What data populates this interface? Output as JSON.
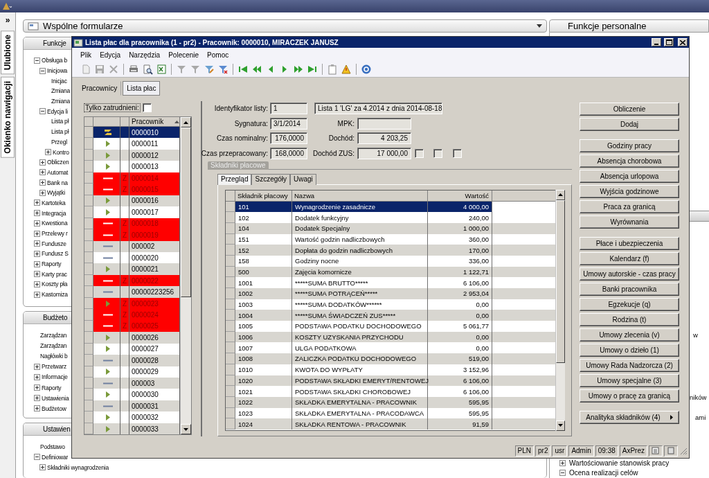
{
  "desktop": {
    "nav_strip": {
      "expand": "»",
      "tabs": [
        "Ulubione",
        "Okienko nawigacji"
      ]
    },
    "forms_selector": {
      "value": "Wspólne formularze"
    },
    "panels": [
      {
        "title": "Funkcje",
        "items": [
          {
            "label": "Obsługa b",
            "kind": "node",
            "expanded": true,
            "children": [
              {
                "label": "Inicjowa",
                "kind": "node",
                "expanded": true,
                "children": [
                  {
                    "label": "Inicjac",
                    "kind": "leaf"
                  },
                  {
                    "label": "Zmiana",
                    "kind": "leaf"
                  },
                  {
                    "label": "Zmiana",
                    "kind": "leaf"
                  }
                ]
              },
              {
                "label": "Edycja li",
                "kind": "node",
                "expanded": true,
                "children": [
                  {
                    "label": "Lista pł",
                    "kind": "leaf"
                  },
                  {
                    "label": "Lista pł",
                    "kind": "leaf"
                  },
                  {
                    "label": "Przegl",
                    "kind": "leaf"
                  },
                  {
                    "label": "Kontro",
                    "kind": "node",
                    "expanded": false
                  }
                ]
              },
              {
                "label": "Obliczen",
                "kind": "node",
                "expanded": false
              },
              {
                "label": "Automat",
                "kind": "node",
                "expanded": false
              },
              {
                "label": "Bank na",
                "kind": "node",
                "expanded": false
              },
              {
                "label": "Wyjątki",
                "kind": "node",
                "expanded": false
              }
            ]
          },
          {
            "label": "Kartoteka",
            "kind": "node",
            "expanded": false
          },
          {
            "label": "Integracja",
            "kind": "node",
            "expanded": false
          },
          {
            "label": "Kwestiona",
            "kind": "node",
            "expanded": false
          },
          {
            "label": "Przelewy r",
            "kind": "node",
            "expanded": false
          },
          {
            "label": "Fundusze",
            "kind": "node",
            "expanded": false
          },
          {
            "label": "Fundusz S",
            "kind": "node",
            "expanded": false
          },
          {
            "label": "Raporty",
            "kind": "node",
            "expanded": false
          },
          {
            "label": "Karty prac",
            "kind": "node",
            "expanded": false
          },
          {
            "label": "Koszty pła",
            "kind": "node",
            "expanded": false
          },
          {
            "label": "Kastomiza",
            "kind": "node",
            "expanded": false
          }
        ]
      },
      {
        "title": "Budżeto",
        "items": [
          {
            "label": "Zarządzan",
            "kind": "leaf"
          },
          {
            "label": "Zarządzan",
            "kind": "leaf"
          },
          {
            "label": "Nagłówki b",
            "kind": "leaf"
          },
          {
            "label": "Przetwarz",
            "kind": "node",
            "expanded": false
          },
          {
            "label": "Informacje",
            "kind": "node",
            "expanded": false
          },
          {
            "label": "Raporty",
            "kind": "node",
            "expanded": false
          },
          {
            "label": "Ustawienia",
            "kind": "node",
            "expanded": false
          },
          {
            "label": "Budżetow",
            "kind": "node",
            "expanded": false
          }
        ]
      },
      {
        "title": "Ustawien",
        "items": [
          {
            "label": "Podstawo",
            "kind": "leaf"
          },
          {
            "label": "Definiowar",
            "kind": "node",
            "expanded": true,
            "children": [
              {
                "label": "Składniki wynagrodzenia",
                "kind": "node",
                "expanded": false
              }
            ]
          }
        ]
      }
    ],
    "personal_panel": {
      "title": "Funkcje personalne",
      "fragments": [
        "w",
        "ników",
        "ami"
      ],
      "items": [
        {
          "label": "Wartościowanie stanowisk pracy",
          "expanded": false
        },
        {
          "label": "Ocena realizacji celów",
          "expanded": true
        }
      ]
    }
  },
  "dialog": {
    "title": "Lista płac dla pracownika (1 - pr2) - Pracownik: 0000010, MIRACZEK JANUSZ",
    "menu": [
      "Plik",
      "Edycja",
      "Narzędzia",
      "Polecenie",
      "Pomoc"
    ],
    "tabs": [
      {
        "label": "Pracownicy",
        "selected": false
      },
      {
        "label": "Lista płac",
        "selected": true
      }
    ],
    "employees": {
      "filter": {
        "label": "Tylko zatrudnieni:",
        "checked": false
      },
      "column": "Pracownik",
      "rows": [
        {
          "id": "0000010",
          "kind": "current",
          "blocked": false,
          "selected": true
        },
        {
          "id": "0000011",
          "kind": "arrow",
          "blocked": false,
          "selected": false
        },
        {
          "id": "0000012",
          "kind": "arrow",
          "blocked": false,
          "selected": false
        },
        {
          "id": "0000013",
          "kind": "arrow",
          "blocked": false,
          "selected": false
        },
        {
          "id": "0000014",
          "kind": "dash",
          "status": "Z",
          "blocked": true,
          "selected": false
        },
        {
          "id": "0000015",
          "kind": "dash",
          "status": "Z",
          "blocked": true,
          "selected": false
        },
        {
          "id": "0000016",
          "kind": "arrow",
          "blocked": false,
          "selected": false
        },
        {
          "id": "0000017",
          "kind": "arrow",
          "blocked": false,
          "selected": false
        },
        {
          "id": "0000018",
          "kind": "dash",
          "status": "Z",
          "blocked": true,
          "selected": false
        },
        {
          "id": "0000019",
          "kind": "dash",
          "status": "Z",
          "blocked": true,
          "selected": false
        },
        {
          "id": "000002",
          "kind": "dash",
          "blocked": false,
          "selected": false
        },
        {
          "id": "0000020",
          "kind": "dash",
          "blocked": false,
          "selected": false
        },
        {
          "id": "0000021",
          "kind": "arrow",
          "blocked": false,
          "selected": false
        },
        {
          "id": "0000022",
          "kind": "dash",
          "status": "Z",
          "blocked": true,
          "selected": false
        },
        {
          "id": "00000223256",
          "kind": "dash",
          "blocked": false,
          "selected": false
        },
        {
          "id": "0000023",
          "kind": "arrow",
          "status": "Z",
          "blocked": true,
          "selected": false
        },
        {
          "id": "0000024",
          "kind": "dash",
          "status": "Z",
          "blocked": true,
          "selected": false
        },
        {
          "id": "0000025",
          "kind": "dash",
          "status": "Z",
          "blocked": true,
          "selected": false
        },
        {
          "id": "0000026",
          "kind": "arrow",
          "blocked": false,
          "selected": false
        },
        {
          "id": "0000027",
          "kind": "arrow",
          "blocked": false,
          "selected": false
        },
        {
          "id": "0000028",
          "kind": "dash",
          "blocked": false,
          "selected": false
        },
        {
          "id": "0000029",
          "kind": "arrow",
          "blocked": false,
          "selected": false
        },
        {
          "id": "000003",
          "kind": "dash",
          "blocked": false,
          "selected": false
        },
        {
          "id": "0000030",
          "kind": "arrow",
          "blocked": false,
          "selected": false
        },
        {
          "id": "0000031",
          "kind": "dash",
          "blocked": false,
          "selected": false
        },
        {
          "id": "0000032",
          "kind": "arrow",
          "blocked": false,
          "selected": false
        },
        {
          "id": "0000033",
          "kind": "arrow",
          "blocked": false,
          "selected": false
        }
      ]
    },
    "form": {
      "list_id": {
        "label": "Identyfikator listy:",
        "value": "1"
      },
      "list_description": {
        "value": "Lista 1 'LG' za 4.2014 z dnia 2014-08-18"
      },
      "signature": {
        "label": "Sygnatura:",
        "value": "3/1/2014"
      },
      "mpk": {
        "label": "MPK:"
      },
      "nominal_time": {
        "label": "Czas nominalny:",
        "value": "176,0000"
      },
      "income": {
        "label": "Dochód:",
        "value": "4 203,25"
      },
      "worked_time": {
        "label": "Czas przepracowany:",
        "value": "168,0000"
      },
      "income_zus": {
        "label": "Dochód ZUS:",
        "value": "17 000,00"
      },
      "flags": [
        {
          "checked": false
        },
        {
          "checked": false
        },
        {
          "checked": false
        }
      ]
    },
    "group_title": "Składniki płacowe",
    "subtabs": [
      {
        "label": "Przegląd",
        "selected": true
      },
      {
        "label": "Szczegóły",
        "selected": false
      },
      {
        "label": "Uwagi",
        "selected": false
      }
    ],
    "pay_table": {
      "columns": [
        "Składnik płacowy",
        "Nazwa",
        "Wartość"
      ],
      "rows": [
        {
          "code": "101",
          "name": "Wynagrodzenie zasadnicze",
          "value": "4 000,00",
          "selected": true
        },
        {
          "code": "102",
          "name": "Dodatek funkcyjny",
          "value": "240,00",
          "selected": false
        },
        {
          "code": "104",
          "name": "Dodatek Specjalny",
          "value": "1 000,00",
          "selected": false
        },
        {
          "code": "151",
          "name": "Wartość godzin nadliczbowych",
          "value": "360,00",
          "selected": false
        },
        {
          "code": "152",
          "name": "Dopłata do godzin nadliczbowych",
          "value": "170,00",
          "selected": false
        },
        {
          "code": "158",
          "name": "Godziny nocne",
          "value": "336,00",
          "selected": false
        },
        {
          "code": "500",
          "name": "Zajęcia komornicze",
          "value": "1 122,71",
          "selected": false
        },
        {
          "code": "1001",
          "name": "*****SUMA BRUTTO*****",
          "value": "6 106,00",
          "selected": false
        },
        {
          "code": "1002",
          "name": "*****SUMA POTRĄCEŃ*****",
          "value": "2 953,04",
          "selected": false
        },
        {
          "code": "1003",
          "name": "*****SUMA DODATKÓW******",
          "value": "0,00",
          "selected": false
        },
        {
          "code": "1004",
          "name": "*****SUMA ŚWIADCZEŃ ZUS*****",
          "value": "0,00",
          "selected": false
        },
        {
          "code": "1005",
          "name": "PODSTAWA PODATKU DOCHODOWEGO",
          "value": "5 061,77",
          "selected": false
        },
        {
          "code": "1006",
          "name": "KOSZTY UZYSKANIA PRZYCHODU",
          "value": "0,00",
          "selected": false
        },
        {
          "code": "1007",
          "name": "ULGA PODATKOWA",
          "value": "0,00",
          "selected": false
        },
        {
          "code": "1008",
          "name": "ZALICZKA PODATKU DOCHODOWEGO",
          "value": "519,00",
          "selected": false
        },
        {
          "code": "1010",
          "name": "KWOTA DO WYPŁATY",
          "value": "3 152,96",
          "selected": false
        },
        {
          "code": "1020",
          "name": "PODSTAWA SKŁADKI EMERYT/RENTOWEJ",
          "value": "6 106,00",
          "selected": false
        },
        {
          "code": "1021",
          "name": "PODSTAWA SKŁADKI CHOROBOWEJ",
          "value": "6 106,00",
          "selected": false
        },
        {
          "code": "1022",
          "name": "SKŁADKA EMERYTALNA - PRACOWNIK",
          "value": "595,95",
          "selected": false
        },
        {
          "code": "1023",
          "name": "SKŁADKA EMERYTALNA - PRACODAWCA",
          "value": "595,95",
          "selected": false
        },
        {
          "code": "1024",
          "name": "SKŁADKA RENTOWA - PRACOWNIK",
          "value": "91,59",
          "selected": false
        }
      ]
    },
    "button_groups": [
      [
        {
          "label": "Obliczenie",
          "submenu": false
        },
        {
          "label": "Dodaj",
          "submenu": false
        }
      ],
      [
        {
          "label": "Godziny pracy",
          "submenu": false
        },
        {
          "label": "Absencja chorobowa",
          "submenu": false
        },
        {
          "label": "Absencja urlopowa",
          "submenu": false
        },
        {
          "label": "Wyjścia godzinowe",
          "submenu": false
        },
        {
          "label": "Praca za granicą",
          "submenu": false
        },
        {
          "label": "Wyrównania",
          "submenu": false
        }
      ],
      [
        {
          "label": "Płace i ubezpieczenia",
          "submenu": false
        },
        {
          "label": "Kalendarz (f)",
          "submenu": false
        },
        {
          "label": "Umowy autorskie - czas pracy",
          "submenu": false
        },
        {
          "label": "Banki pracownika",
          "submenu": false
        },
        {
          "label": "Egzekucje (q)",
          "submenu": false
        },
        {
          "label": "Rodzina (t)",
          "submenu": false
        },
        {
          "label": "Umowy zlecenia (v)",
          "submenu": false
        },
        {
          "label": "Umowy o dzieło (1)",
          "submenu": false
        },
        {
          "label": "Umowy Rada Nadzorcza (2)",
          "submenu": false
        },
        {
          "label": "Umowy specjalne (3)",
          "submenu": false
        },
        {
          "label": "Umowy o pracę za granicą",
          "submenu": false
        }
      ],
      [
        {
          "label": "Analityka składników (4)",
          "submenu": true
        }
      ]
    ],
    "status_bar": [
      "PLN",
      "pr2",
      "usr",
      "Admin",
      "09:38",
      "AxPrez"
    ]
  }
}
